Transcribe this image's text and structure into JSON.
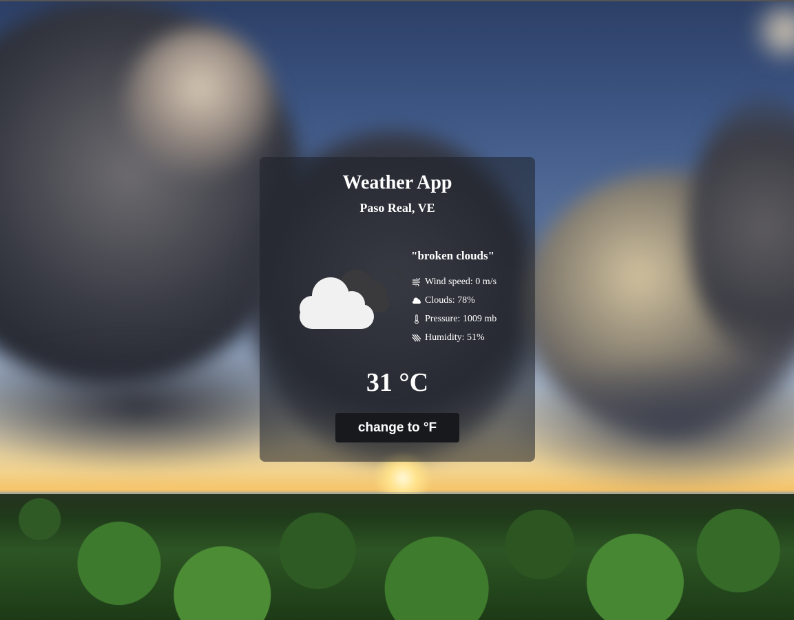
{
  "app": {
    "title": "Weather App",
    "location": "Paso Real, VE"
  },
  "weather": {
    "description": "\"broken clouds\"",
    "icon": "broken-clouds-icon",
    "details": [
      {
        "icon": "wind-icon",
        "label": "Wind speed: 0 m/s"
      },
      {
        "icon": "cloud-small-icon",
        "label": "Clouds: 78%"
      },
      {
        "icon": "thermometer-icon",
        "label": "Pressure: 1009 mb"
      },
      {
        "icon": "humidity-icon",
        "label": "Humidity: 51%"
      }
    ],
    "temperature": "31 °C"
  },
  "controls": {
    "toggle_unit_label": "change to °F"
  },
  "colors": {
    "card_bg": "rgba(30,32,40,0.55)",
    "button_bg": "#17191d",
    "text": "#ffffff"
  }
}
